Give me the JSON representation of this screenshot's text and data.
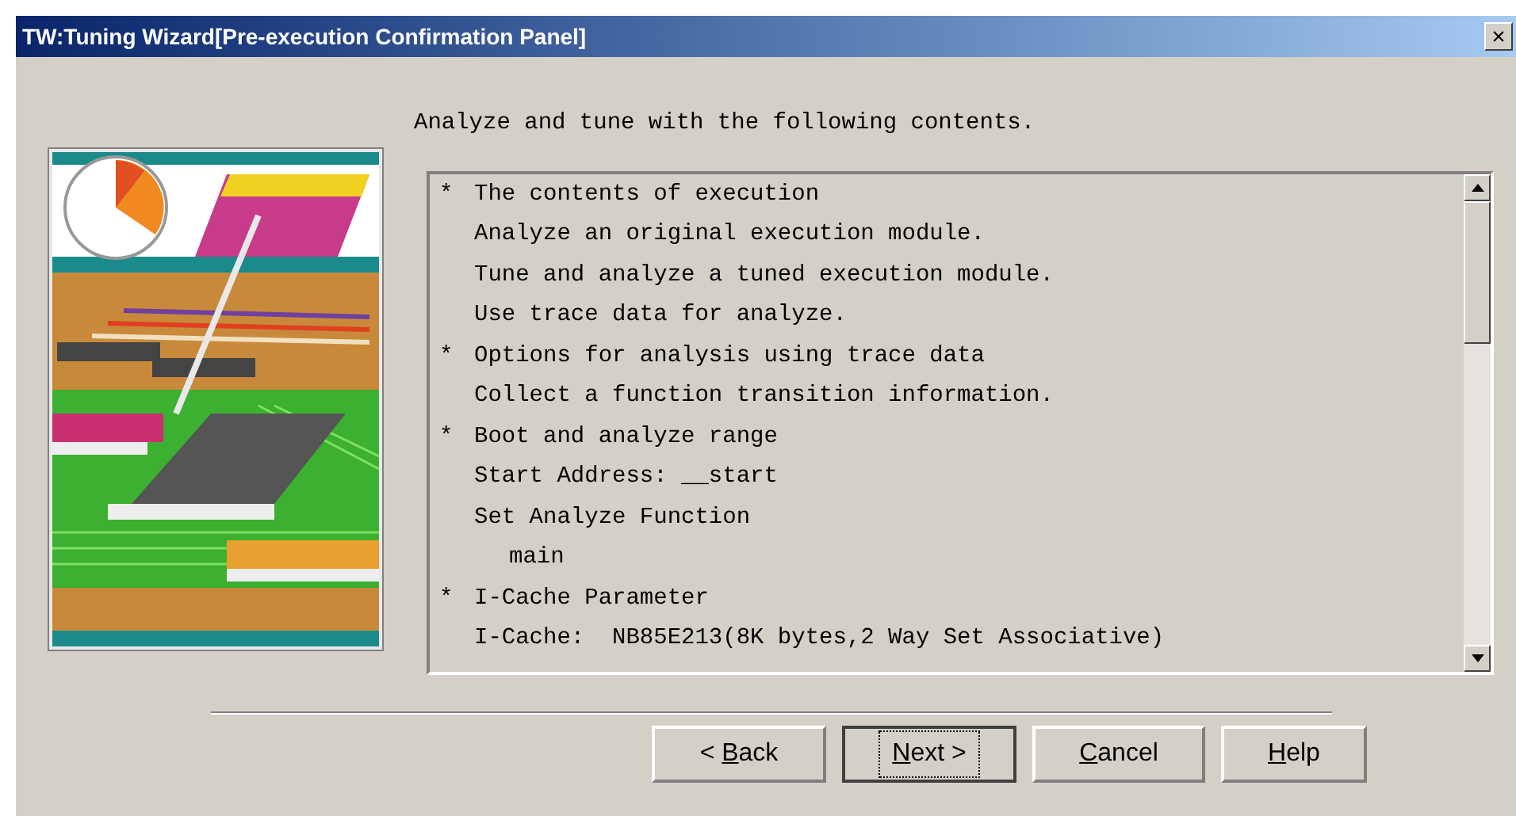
{
  "window": {
    "title": "TW:Tuning Wizard[Pre-execution Confirmation Panel]",
    "close": "×"
  },
  "intro": "Analyze and tune with the following contents.",
  "contents": [
    {
      "kind": "heading",
      "bullet": "*",
      "text": "The contents of execution"
    },
    {
      "kind": "item",
      "text": "Analyze an original execution module."
    },
    {
      "kind": "item",
      "text": "Tune and analyze a tuned execution module."
    },
    {
      "kind": "item",
      "text": "Use trace data for analyze."
    },
    {
      "kind": "heading",
      "bullet": "*",
      "text": "Options for analysis using trace data"
    },
    {
      "kind": "item",
      "text": "Collect a function transition information."
    },
    {
      "kind": "heading",
      "bullet": "*",
      "text": "Boot and analyze range"
    },
    {
      "kind": "item",
      "text": "Start Address: __start"
    },
    {
      "kind": "item",
      "text": "Set Analyze Function",
      "children": [
        {
          "text": "main"
        }
      ]
    },
    {
      "kind": "heading",
      "bullet": "*",
      "text": "I-Cache Parameter"
    },
    {
      "kind": "item",
      "text": "I-Cache:  NB85E213(8K bytes,2 Way Set Associative)"
    }
  ],
  "buttons": [
    {
      "before": "< ",
      "key": "B",
      "after": "ack",
      "default": false
    },
    {
      "key": "N",
      "after": "ext >",
      "default": true
    },
    {
      "key": "C",
      "after": "ancel",
      "default": false
    },
    {
      "key": "H",
      "after": "elp",
      "default": false
    }
  ]
}
